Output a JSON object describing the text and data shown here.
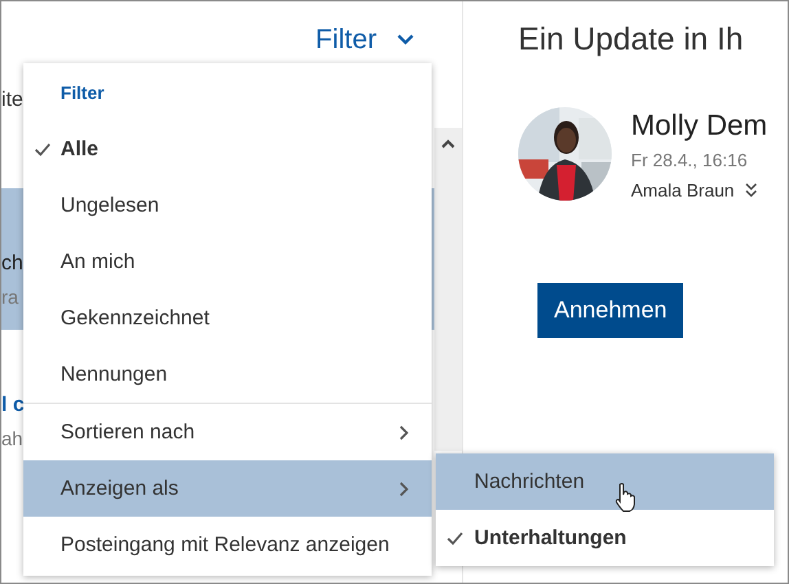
{
  "list_pane": {
    "filter_label": "Filter",
    "search_fragment": "ite",
    "messages": [
      {
        "line_1": "ch",
        "line_2": "ra",
        "selected": true
      },
      {
        "line_1": "l c",
        "line_2": "ah",
        "selected": false
      }
    ]
  },
  "reading_pane": {
    "subject": "Ein Update in Ih",
    "sender": "Molly Dem",
    "date": "Fr 28.4., 16:16",
    "recipient": "Amala Braun",
    "accept_button": "Annehmen"
  },
  "filter_menu": {
    "heading": "Filter",
    "items": [
      {
        "label": "Alle",
        "kind": "option",
        "checked": true
      },
      {
        "label": "Ungelesen",
        "kind": "option",
        "checked": false
      },
      {
        "label": "An mich",
        "kind": "option",
        "checked": false
      },
      {
        "label": "Gekennzeichnet",
        "kind": "option",
        "checked": false
      },
      {
        "label": "Nennungen",
        "kind": "option",
        "checked": false
      },
      {
        "label": "Sortieren nach",
        "kind": "submenu",
        "selected": false,
        "divider_before": true
      },
      {
        "label": "Anzeigen als",
        "kind": "submenu",
        "selected": true
      },
      {
        "label": "Posteingang mit Relevanz anzeigen",
        "kind": "option",
        "checked": false
      }
    ]
  },
  "submenu": {
    "items": [
      {
        "label": "Nachrichten",
        "checked": false,
        "selected": true
      },
      {
        "label": "Unterhaltungen",
        "checked": true,
        "selected": false
      }
    ]
  }
}
